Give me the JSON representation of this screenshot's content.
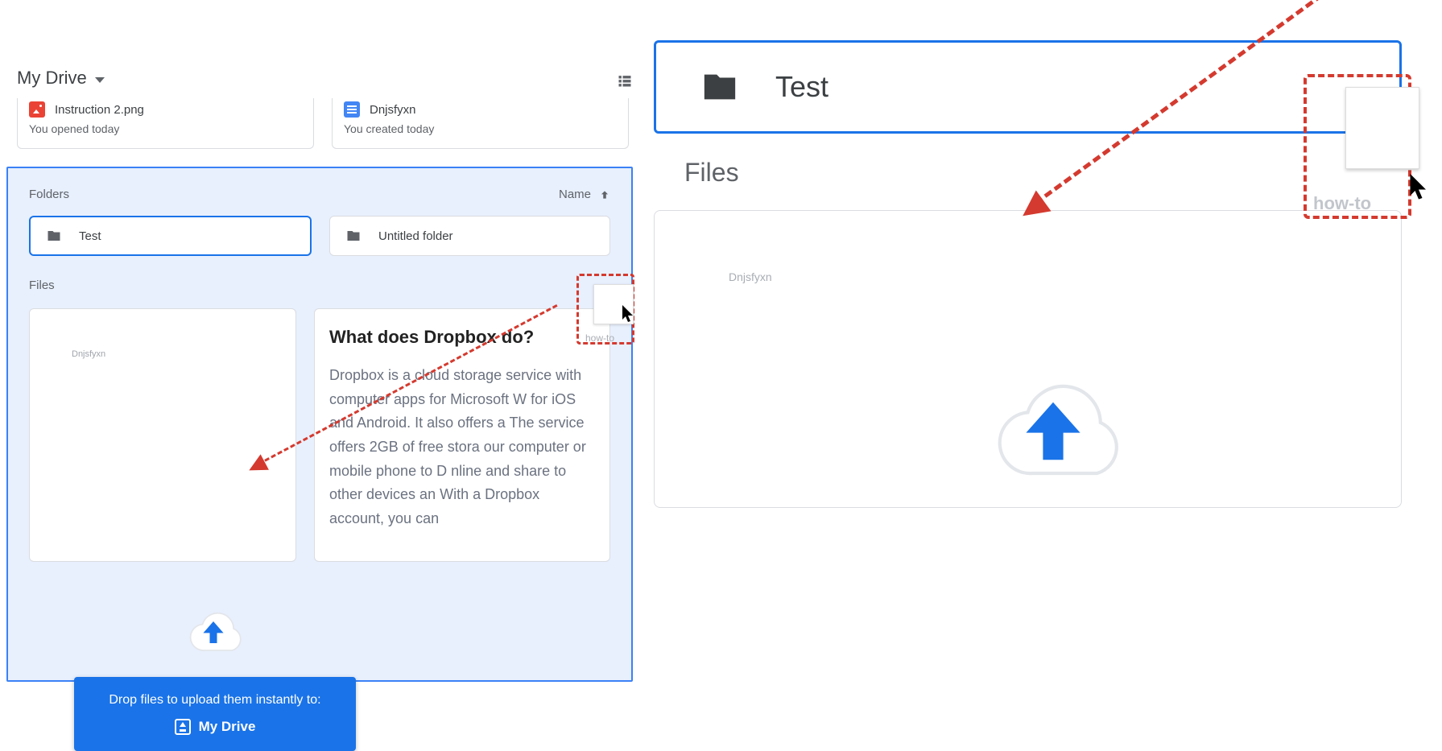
{
  "left": {
    "breadcrumb": "My Drive",
    "recents": [
      {
        "icon": "image",
        "title": "Instruction 2.png",
        "sub": "You opened today"
      },
      {
        "icon": "doc",
        "title": "Dnjsfyxn",
        "sub": "You created today"
      }
    ],
    "section_folders": "Folders",
    "sort_label": "Name",
    "folders": [
      {
        "name": "Test",
        "selected": true
      },
      {
        "name": "Untitled folder",
        "selected": false
      }
    ],
    "section_files": "Files",
    "file_preview": {
      "heading": "What does Dropbox do?",
      "body": "Dropbox is a cloud storage service with computer apps for Microsoft W for iOS and Android. It also offers a The service offers 2GB of free stora our computer or mobile phone to D nline and share to other devices an With a Dropbox account, you can"
    },
    "ghost_text": "Dnjsfyxn",
    "drop_toast_line1": "Drop files to upload them instantly to:",
    "drop_toast_target": "My Drive",
    "drag_caption": "how-to"
  },
  "right": {
    "folder_name": "Test",
    "section_files": "Files",
    "ghost_text": "Dnjsfyxn",
    "drag_caption": "how-to"
  }
}
